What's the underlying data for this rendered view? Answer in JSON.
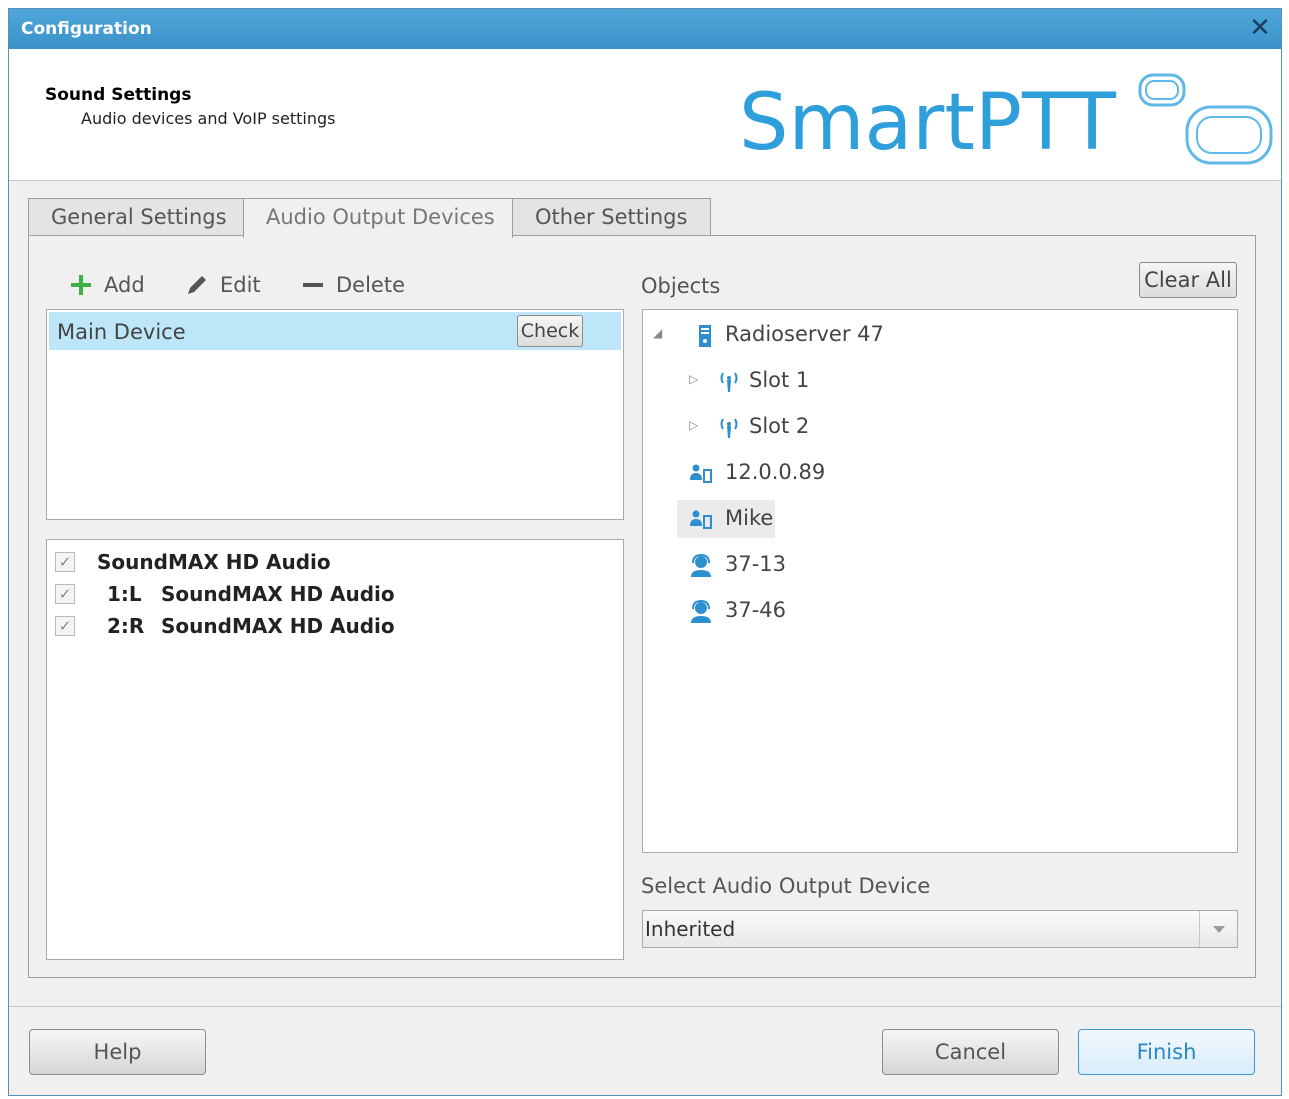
{
  "window": {
    "title": "Configuration",
    "close_glyph": "✕"
  },
  "header": {
    "title": "Sound Settings",
    "subtitle": "Audio devices and VoIP settings",
    "logo_text": "SmartPTT",
    "brand_color": "#3aa6e0"
  },
  "tabs": [
    {
      "label": "General Settings",
      "active": false
    },
    {
      "label": "Audio Output Devices",
      "active": true
    },
    {
      "label": "Other Settings",
      "active": false
    }
  ],
  "toolbar": {
    "add": {
      "label": "Add",
      "icon": "plus-icon"
    },
    "edit": {
      "label": "Edit",
      "icon": "pencil-icon"
    },
    "delete": {
      "label": "Delete",
      "icon": "minus-icon"
    }
  },
  "devices": [
    {
      "name": "Main Device",
      "check_label": "Check",
      "selected": true
    }
  ],
  "channels": [
    {
      "index": "",
      "name": "SoundMAX HD Audio",
      "checked": true
    },
    {
      "index": "1:L",
      "name": "SoundMAX HD Audio",
      "checked": true
    },
    {
      "index": "2:R",
      "name": "SoundMAX HD Audio",
      "checked": true
    }
  ],
  "objects": {
    "label": "Objects",
    "clear_all_label": "Clear All",
    "tree": [
      {
        "label": "Radioserver 47",
        "icon": "server-icon",
        "expander": "expanded"
      },
      {
        "label": "Slot 1",
        "icon": "antenna-icon",
        "expander": "collapsed"
      },
      {
        "label": "Slot 2",
        "icon": "antenna-icon",
        "expander": "collapsed"
      },
      {
        "label": "12.0.0.89",
        "icon": "radio-user-icon",
        "expander": "none"
      },
      {
        "label": "Mike",
        "icon": "radio-user-icon",
        "expander": "none",
        "highlighted": true
      },
      {
        "label": "37-13",
        "icon": "dispatcher-icon",
        "expander": "none"
      },
      {
        "label": "37-46",
        "icon": "dispatcher-icon",
        "expander": "none"
      }
    ]
  },
  "select_output": {
    "label": "Select Audio Output Device",
    "value": "Inherited"
  },
  "footer": {
    "help_label": "Help",
    "cancel_label": "Cancel",
    "finish_label": "Finish"
  }
}
